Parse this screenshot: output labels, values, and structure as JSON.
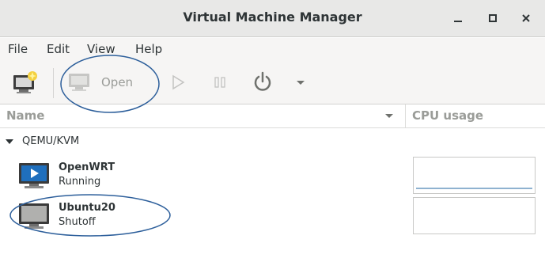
{
  "window": {
    "title": "Virtual Machine Manager"
  },
  "menu": {
    "file": "File",
    "edit": "Edit",
    "view": "View",
    "help": "Help"
  },
  "toolbar": {
    "open_label": "Open"
  },
  "columns": {
    "name": "Name",
    "cpu": "CPU usage"
  },
  "group": {
    "label": "QEMU/KVM"
  },
  "vms": [
    {
      "name": "OpenWRT",
      "status": "Running",
      "cpu_usage": 0.02
    },
    {
      "name": "Ubuntu20",
      "status": "Shutoff"
    }
  ],
  "colors": {
    "accent": "#1e6fb3",
    "annotation": "#2d5f9b",
    "cpu_line": "#8fb2d0"
  },
  "icons": [
    "new-vm-icon",
    "monitor-icon",
    "play-icon",
    "pause-icon",
    "power-icon",
    "chevron-down-icon"
  ]
}
